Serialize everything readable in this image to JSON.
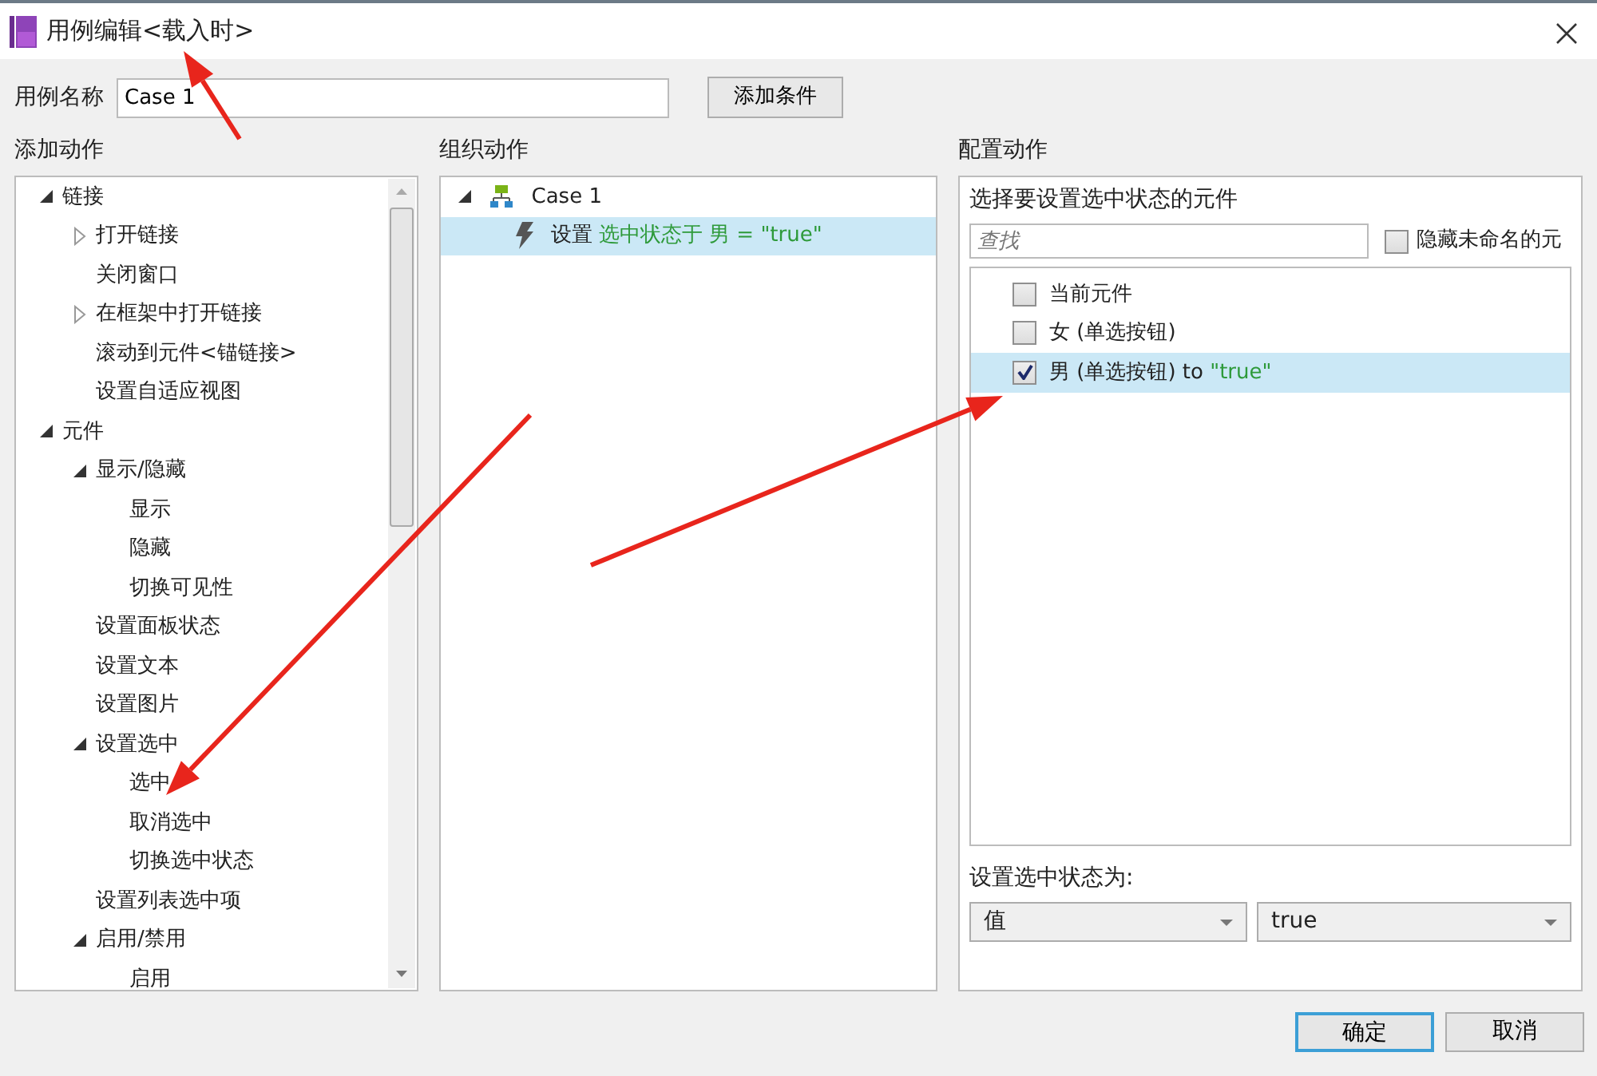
{
  "window": {
    "title": "用例编辑<载入时>"
  },
  "case_name": {
    "label": "用例名称",
    "value": "Case 1"
  },
  "add_condition_button": "添加条件",
  "add_actions": {
    "heading": "添加动作",
    "tree": [
      {
        "label": "链接",
        "expanded": true,
        "children": [
          {
            "label": "打开链接",
            "expanded": false
          },
          {
            "label": "关闭窗口"
          },
          {
            "label": "在框架中打开链接",
            "expanded": false
          },
          {
            "label": "滚动到元件<锚链接>"
          },
          {
            "label": "设置自适应视图"
          }
        ]
      },
      {
        "label": "元件",
        "expanded": true,
        "children": [
          {
            "label": "显示/隐藏",
            "expanded": true,
            "children": [
              {
                "label": "显示"
              },
              {
                "label": "隐藏"
              },
              {
                "label": "切换可见性"
              }
            ]
          },
          {
            "label": "设置面板状态"
          },
          {
            "label": "设置文本"
          },
          {
            "label": "设置图片"
          },
          {
            "label": "设置选中",
            "expanded": true,
            "children": [
              {
                "label": "选中"
              },
              {
                "label": "取消选中"
              },
              {
                "label": "切换选中状态"
              }
            ]
          },
          {
            "label": "设置列表选中项"
          },
          {
            "label": "启用/禁用",
            "expanded": true,
            "children": [
              {
                "label": "启用"
              }
            ]
          }
        ]
      }
    ]
  },
  "organize_actions": {
    "heading": "组织动作",
    "cases": [
      {
        "label": "Case 1",
        "expanded": true,
        "actions": [
          {
            "verb": "设置",
            "detail": "选中状态于 男 = \"true\"",
            "selected": true
          }
        ]
      }
    ]
  },
  "configure_action": {
    "heading": "配置动作",
    "prompt": "选择要设置选中状态的元件",
    "search": {
      "placeholder": "查找"
    },
    "hide_unnamed": {
      "label": "隐藏未命名的元",
      "checked": false
    },
    "widgets": [
      {
        "label": "当前元件",
        "checked": false,
        "selected": false
      },
      {
        "label": "女 (单选按钮)",
        "checked": false,
        "selected": false
      },
      {
        "label": "男 (单选按钮)",
        "connector": "to",
        "value": "\"true\"",
        "checked": true,
        "selected": true
      }
    ],
    "set_state_label": "设置选中状态为:",
    "type_select": "值",
    "value_select": "true"
  },
  "buttons": [
    {
      "label": "确定",
      "default": true
    },
    {
      "label": "取消",
      "default": false
    }
  ]
}
